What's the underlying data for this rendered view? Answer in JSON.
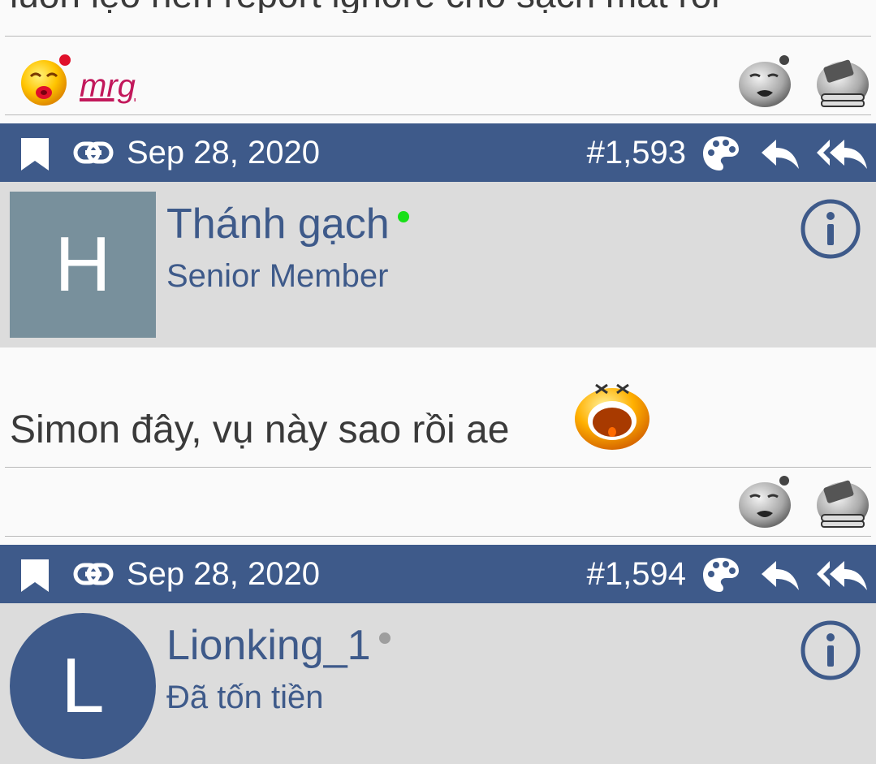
{
  "prev_post": {
    "text_cutoff": "luôn lẹo nên report ignore cho sạch mắt rồi",
    "reactor": {
      "name": "mrg",
      "emoji_icon": "kiss-emoji-icon"
    },
    "reaction_icons": [
      "sleepy-face-icon",
      "bored-face-icon"
    ]
  },
  "posts": [
    {
      "date": "Sep 28, 2020",
      "number": "#1,593",
      "user": {
        "avatar_letter": "H",
        "name": "Thánh gạch",
        "title": "Senior Member",
        "online": true
      },
      "body_text": "Simon đây, vụ này sao rồi ae",
      "body_emoji_icon": "shouting-emoji-icon",
      "reaction_icons": [
        "sleepy-face-icon",
        "bored-face-icon"
      ]
    },
    {
      "date": "Sep 28, 2020",
      "number": "#1,594",
      "user": {
        "avatar_letter": "L",
        "name": "Lionking_1",
        "title": "Đã tốn tiền",
        "online": false
      }
    }
  ],
  "colors": {
    "bar": "#3e5a8a",
    "online": "#18e018",
    "offline": "#9e9e9e",
    "link_pink": "#c2185b"
  }
}
